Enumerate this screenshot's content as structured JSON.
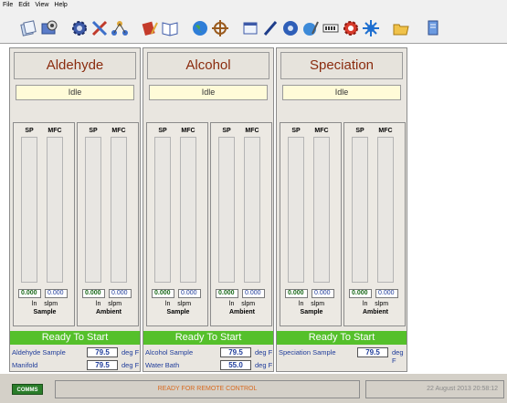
{
  "menu": [
    "File",
    "Edit",
    "View",
    "Help"
  ],
  "toolbar_icons": [
    "pages-icon",
    "folder-gear-icon",
    "gear-icon",
    "tools-icon",
    "network-icon",
    "book-pencil-icon",
    "book-open-icon",
    "globe-icon",
    "ship-wheel-icon",
    "window-icon",
    "pen-icon",
    "disc-icon",
    "globe-pen-icon",
    "meter-icon",
    "red-gear-icon",
    "star-burst-icon",
    "open-folder-icon",
    "document-icon"
  ],
  "panels": [
    {
      "title": "Aldehyde",
      "status": "Idle",
      "gauge_labels": [
        "SP",
        "MFC",
        "SP",
        "MFC"
      ],
      "groups": [
        {
          "name": "Sample",
          "sp": "0.000",
          "mfc": "0.000"
        },
        {
          "name": "Ambient",
          "sp": "0.000",
          "mfc": "0.000"
        }
      ],
      "units": "ln slpm",
      "ready": "Ready To Start",
      "rows": [
        {
          "label": "Aldehyde Sample",
          "value": "79.5",
          "unit": "deg F"
        },
        {
          "label": "Manifold",
          "value": "79.5",
          "unit": "deg F"
        }
      ]
    },
    {
      "title": "Alcohol",
      "status": "Idle",
      "gauge_labels": [
        "SP",
        "MFC",
        "SP",
        "MFC"
      ],
      "groups": [
        {
          "name": "Sample",
          "sp": "0.000",
          "mfc": "0.000"
        },
        {
          "name": "Ambient",
          "sp": "0.000",
          "mfc": "0.000"
        }
      ],
      "units": "ln slpm",
      "ready": "Ready To Start",
      "rows": [
        {
          "label": "Alcohol Sample",
          "value": "79.5",
          "unit": "deg F"
        },
        {
          "label": "Water Bath",
          "value": "55.0",
          "unit": "deg F"
        }
      ]
    },
    {
      "title": "Speciation",
      "status": "Idle",
      "gauge_labels": [
        "SP",
        "MFC",
        "SP",
        "MFC"
      ],
      "groups": [
        {
          "name": "Sample",
          "sp": "0.000",
          "mfc": "0.000"
        },
        {
          "name": "Ambient",
          "sp": "0.000",
          "mfc": "0.000"
        }
      ],
      "units": "ln slpm",
      "ready": "Ready To Start",
      "rows": [
        {
          "label": "Speciation Sample",
          "value": "79.5",
          "unit": "deg F"
        }
      ]
    }
  ],
  "statusbar": {
    "comms": "COMMS",
    "message": "READY FOR REMOTE CONTROL",
    "datetime": "22 August 2013  20:58:12"
  },
  "colors": {
    "title": "#8a2b0e",
    "ready": "#55c02b",
    "label_blue": "#1f3c9a",
    "status_message": "#d86a20",
    "comms": "#2a7d2a"
  }
}
